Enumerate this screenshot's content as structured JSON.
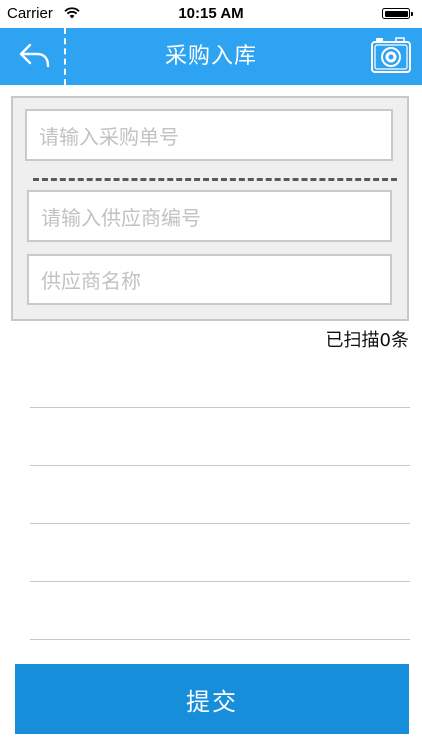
{
  "status_bar": {
    "carrier": "Carrier",
    "time": "10:15 AM"
  },
  "nav": {
    "title": "采购入库",
    "back_icon": "back-arrow-icon",
    "camera_icon": "camera-icon"
  },
  "form": {
    "order_no_placeholder": "请输入采购单号",
    "supplier_no_placeholder": "请输入供应商编号",
    "supplier_name_placeholder": "供应商名称"
  },
  "scan_count": "已扫描0条",
  "submit_label": "提交",
  "colors": {
    "nav_background": "#2da3f2",
    "submit_background": "#168ed9",
    "panel_background": "#efeff0"
  }
}
